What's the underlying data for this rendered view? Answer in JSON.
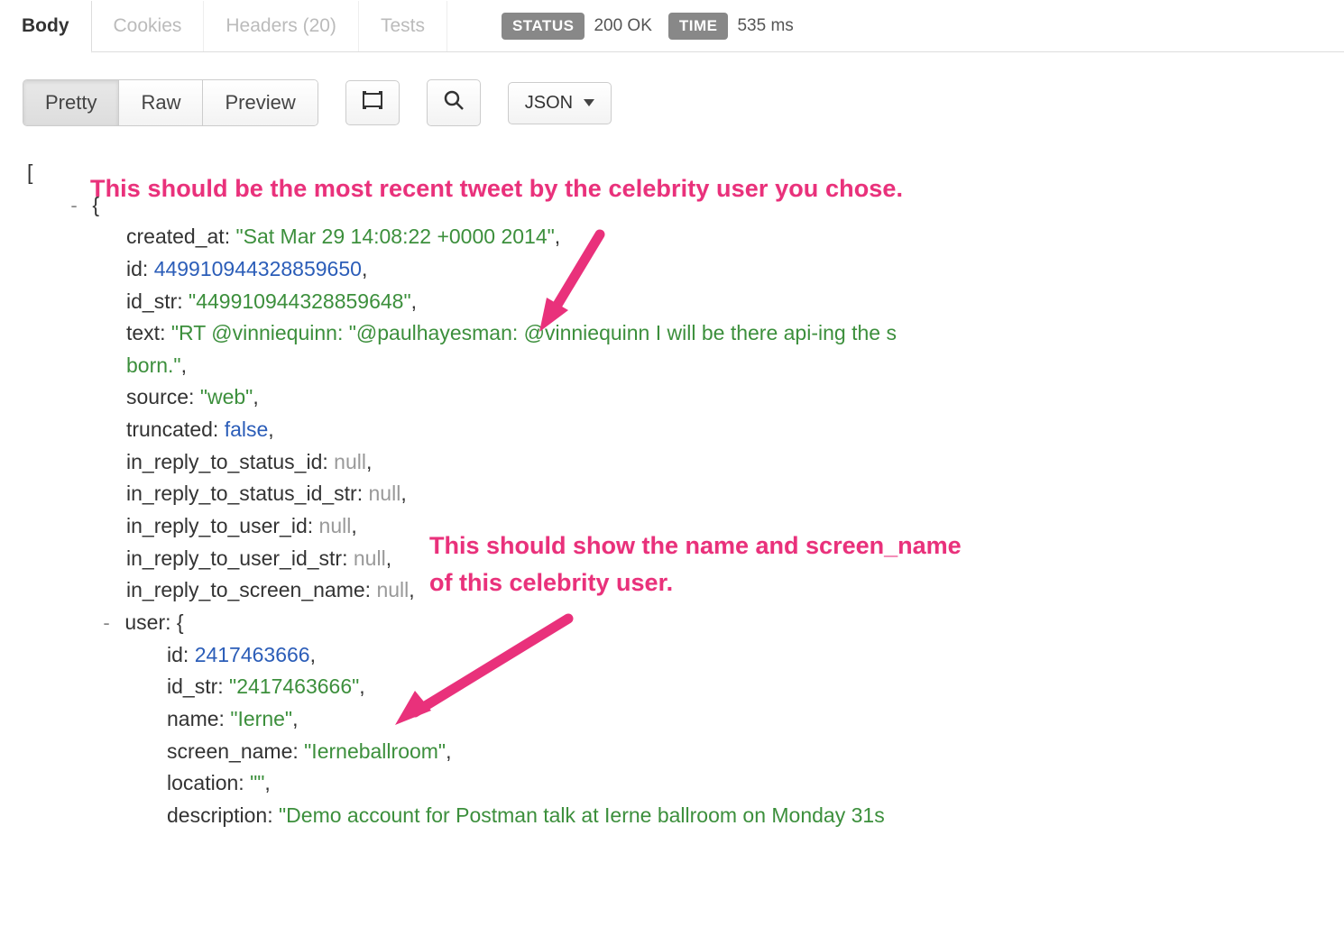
{
  "tabs": {
    "body": "Body",
    "cookies": "Cookies",
    "headers": "Headers (20)",
    "tests": "Tests"
  },
  "status": {
    "status_label": "STATUS",
    "status_value": "200 OK",
    "time_label": "TIME",
    "time_value": "535 ms"
  },
  "toolbar": {
    "pretty": "Pretty",
    "raw": "Raw",
    "preview": "Preview",
    "format_dropdown": "JSON"
  },
  "annotations": {
    "a1": "This should be the most recent tweet by the celebrity user you chose.",
    "a2_line1": "This should show the name and screen_name",
    "a2_line2": "of this celebrity user."
  },
  "json": {
    "created_at_key": "created_at",
    "created_at_val": "\"Sat Mar 29 14:08:22 +0000 2014\"",
    "id_key": "id",
    "id_val": "449910944328859650",
    "id_str_key": "id_str",
    "id_str_val": "\"449910944328859648\"",
    "text_key": "text",
    "text_val": "\"RT @vinniequinn: \"@paulhayesman: @vinniequinn I will be there api-ing the s",
    "text_cont": "born.\"",
    "source_key": "source",
    "source_val": "\"web\"",
    "truncated_key": "truncated",
    "truncated_val": "false",
    "r1_key": "in_reply_to_status_id",
    "r1_val": "null",
    "r2_key": "in_reply_to_status_id_str",
    "r2_val": "null",
    "r3_key": "in_reply_to_user_id",
    "r3_val": "null",
    "r4_key": "in_reply_to_user_id_str",
    "r4_val": "null",
    "r5_key": "in_reply_to_screen_name",
    "r5_val": "null",
    "user_key": "user",
    "u_id_key": "id",
    "u_id_val": "2417463666",
    "u_idstr_key": "id_str",
    "u_idstr_val": "\"2417463666\"",
    "u_name_key": "name",
    "u_name_val": "\"Ierne\"",
    "u_sn_key": "screen_name",
    "u_sn_val": "\"Ierneballroom\"",
    "u_loc_key": "location",
    "u_loc_val": "\"\"",
    "u_desc_key": "description",
    "u_desc_val": "\"Demo account for Postman talk at Ierne ballroom on Monday 31s"
  }
}
